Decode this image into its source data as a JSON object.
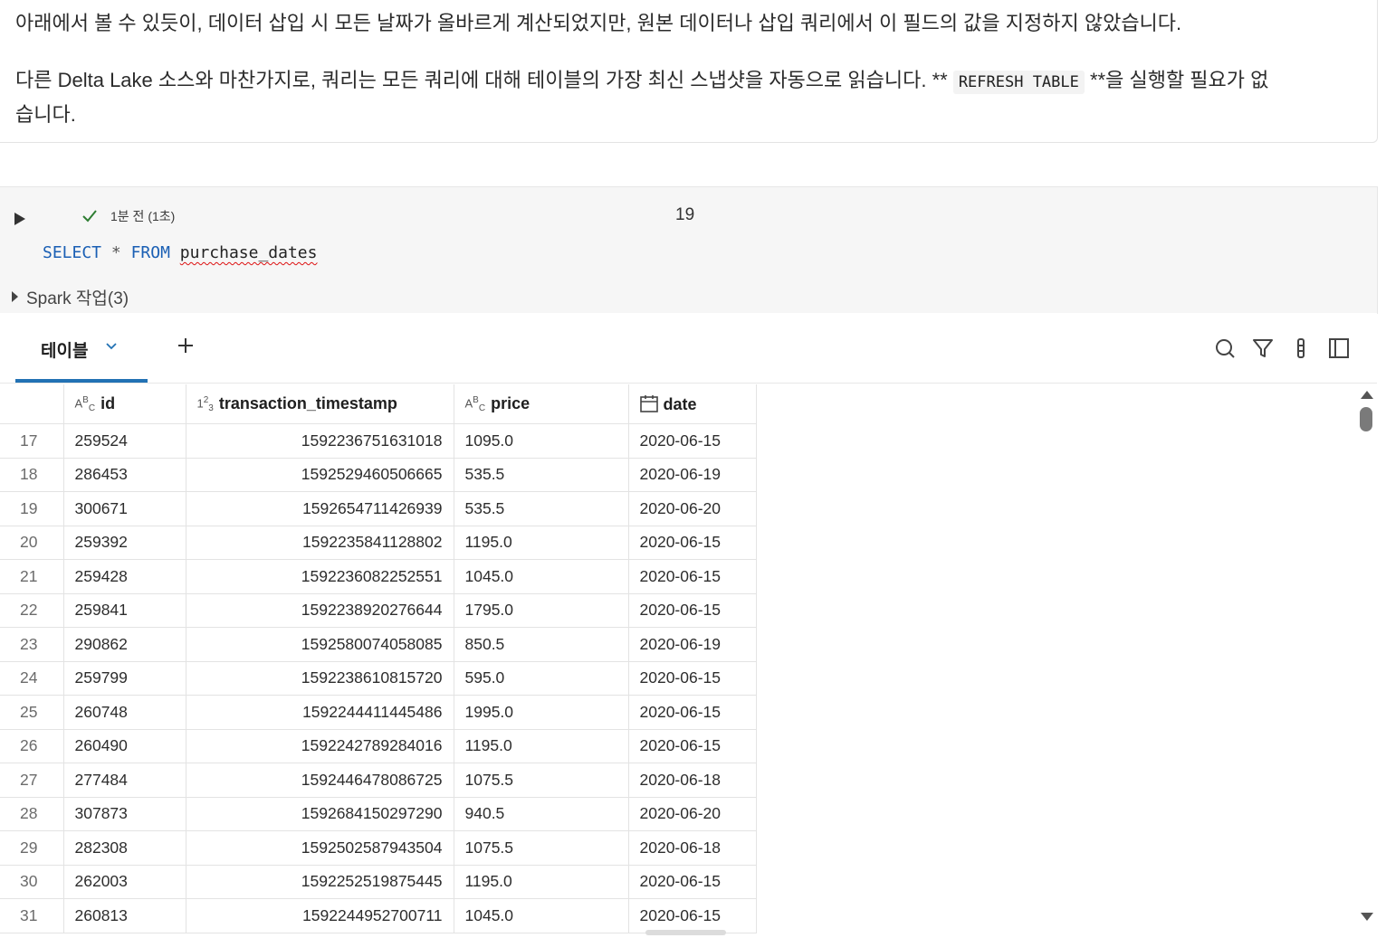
{
  "markdown": {
    "para1": "아래에서 볼 수 있듯이, 데이터 삽입 시 모든 날짜가 올바르게 계산되었지만, 원본 데이터나 삽입 쿼리에서 이 필드의 값을 지정하지 않았습니다.",
    "para2_before": "다른 Delta Lake 소스와 마찬가지로, 쿼리는 모든 쿼리에 대해 테이블의 가장 최신 스냅샷을 자동으로 읽습니다. ** ",
    "para2_code": "REFRESH TABLE",
    "para2_after": " **을 실행할 필요가 없",
    "para2_wrap": "습니다."
  },
  "cell": {
    "status": "1분 전 (1초)",
    "number": "19",
    "code_kw1": "SELECT",
    "code_star": "*",
    "code_kw2": "FROM",
    "code_table": "purchase_dates",
    "spark_jobs": "Spark 작업(3)"
  },
  "results": {
    "tab_label": "테이블",
    "columns": [
      {
        "type": "string",
        "type_label": "ABC",
        "name": "id"
      },
      {
        "type": "integer",
        "type_label": "123",
        "name": "transaction_timestamp"
      },
      {
        "type": "string",
        "type_label": "ABC",
        "name": "price"
      },
      {
        "type": "date",
        "type_label": "calendar",
        "name": "date"
      }
    ],
    "rows": [
      [
        "17",
        "259524",
        "1592236751631018",
        "1095.0",
        "2020-06-15"
      ],
      [
        "18",
        "286453",
        "1592529460506665",
        "535.5",
        "2020-06-19"
      ],
      [
        "19",
        "300671",
        "1592654711426939",
        "535.5",
        "2020-06-20"
      ],
      [
        "20",
        "259392",
        "1592235841128802",
        "1195.0",
        "2020-06-15"
      ],
      [
        "21",
        "259428",
        "1592236082252551",
        "1045.0",
        "2020-06-15"
      ],
      [
        "22",
        "259841",
        "1592238920276644",
        "1795.0",
        "2020-06-15"
      ],
      [
        "23",
        "290862",
        "1592580074058085",
        "850.5",
        "2020-06-19"
      ],
      [
        "24",
        "259799",
        "1592238610815720",
        "595.0",
        "2020-06-15"
      ],
      [
        "25",
        "260748",
        "1592244411445486",
        "1995.0",
        "2020-06-15"
      ],
      [
        "26",
        "260490",
        "1592242789284016",
        "1195.0",
        "2020-06-15"
      ],
      [
        "27",
        "277484",
        "1592446478086725",
        "1075.5",
        "2020-06-18"
      ],
      [
        "28",
        "307873",
        "1592684150297290",
        "940.5",
        "2020-06-20"
      ],
      [
        "29",
        "282308",
        "1592502587943504",
        "1075.5",
        "2020-06-18"
      ],
      [
        "30",
        "262003",
        "1592252519875445",
        "1195.0",
        "2020-06-15"
      ],
      [
        "31",
        "260813",
        "1592244952700711",
        "1045.0",
        "2020-06-15"
      ]
    ]
  },
  "icons": {
    "run": "play-icon",
    "status": "check-icon",
    "tab_menu": "chevron-down-icon",
    "add": "plus-icon",
    "search": "search-icon",
    "filter": "filter-icon",
    "more": "kebab-icon",
    "panel": "sidebar-panel-icon"
  },
  "colors": {
    "accent": "#2272b4",
    "success": "#2e7d32",
    "keyword": "#1a5fb4"
  }
}
